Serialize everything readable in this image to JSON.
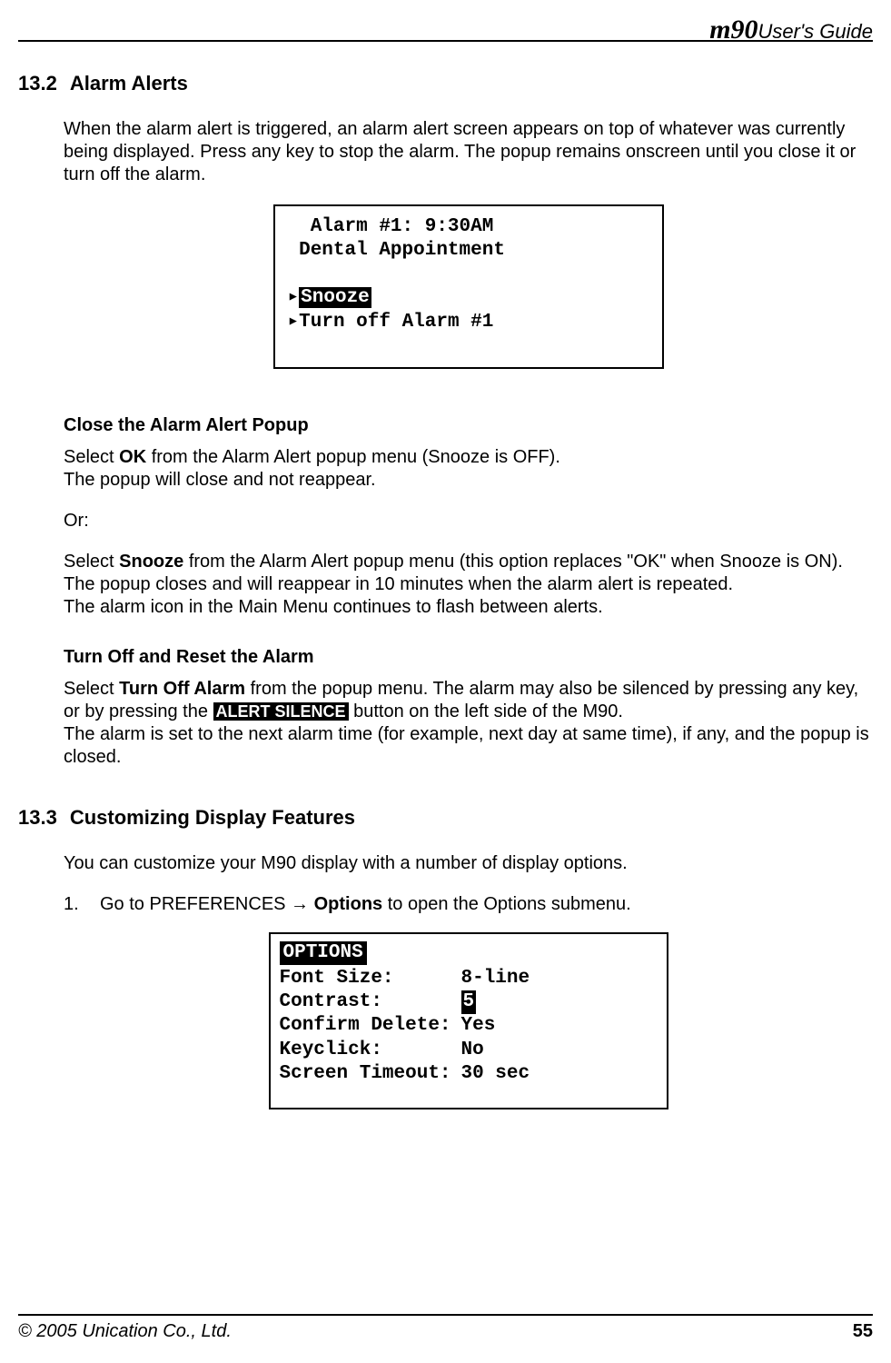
{
  "header": {
    "product": "m90",
    "title_suffix": "User's Guide"
  },
  "section_13_2": {
    "number": "13.2",
    "title": "Alarm Alerts",
    "intro": "When the alarm alert is triggered, an alarm alert screen appears on top of whatever was currently being displayed. Press any key to stop the alarm. The popup remains onscreen until you close it or turn off the alarm."
  },
  "alarm_screen": {
    "line1": "  Alarm #1: 9:30AM",
    "line2": " Dental Appointment",
    "snooze_marker": "▸",
    "snooze_label": "Snooze",
    "turnoff_marker": "▸",
    "turnoff_label": "Turn off Alarm #1"
  },
  "close_popup": {
    "heading": "Close the Alarm Alert Popup",
    "p1_a": "Select ",
    "p1_b_bold": "OK",
    "p1_c": " from the Alarm Alert popup menu (Snooze is OFF).",
    "p1_line2": "The popup will close and not reappear.",
    "or": "Or:",
    "p2_a": "Select ",
    "p2_b_bold": "Snooze",
    "p2_c": " from the Alarm Alert popup menu (this option replaces \"OK\" when Snooze is ON).",
    "p2_line2": "The popup closes and will reappear in 10 minutes when the alarm alert is repeated.",
    "p2_line3": "The alarm icon in the Main Menu continues to flash between alerts."
  },
  "turn_off": {
    "heading": "Turn Off and Reset the Alarm",
    "p_a": "Select ",
    "p_b_bold": "Turn Off Alarm",
    "p_c": " from the popup menu. The alarm may also be silenced by pressing any key, or by pressing the ",
    "p_d_inv": "ALERT SILENCE",
    "p_e": " button on the left side of the M90.",
    "p_line2": "The alarm is set to the next alarm time (for example, next day at same time), if any, and the popup is closed."
  },
  "section_13_3": {
    "number": "13.3",
    "title": "Customizing Display Features",
    "intro": "You can customize your M90 display with a number of display options.",
    "step1_num": "1.",
    "step1_a": "Go to PREFERENCES → ",
    "step1_b_bold": "Options",
    "step1_c": " to open the Options submenu."
  },
  "options_screen": {
    "title": " OPTIONS ",
    "rows": [
      {
        "label": "Font Size:",
        "value": "8-line",
        "inv": false
      },
      {
        "label": "Contrast:",
        "value": "5",
        "inv": true
      },
      {
        "label": "Confirm Delete:",
        "value": "Yes",
        "inv": false
      },
      {
        "label": "Keyclick:",
        "value": "No",
        "inv": false
      },
      {
        "label": "Screen Timeout:",
        "value": "30 sec",
        "inv": false
      }
    ]
  },
  "footer": {
    "copyright": "© 2005 Unication Co., Ltd.",
    "page": "55"
  }
}
